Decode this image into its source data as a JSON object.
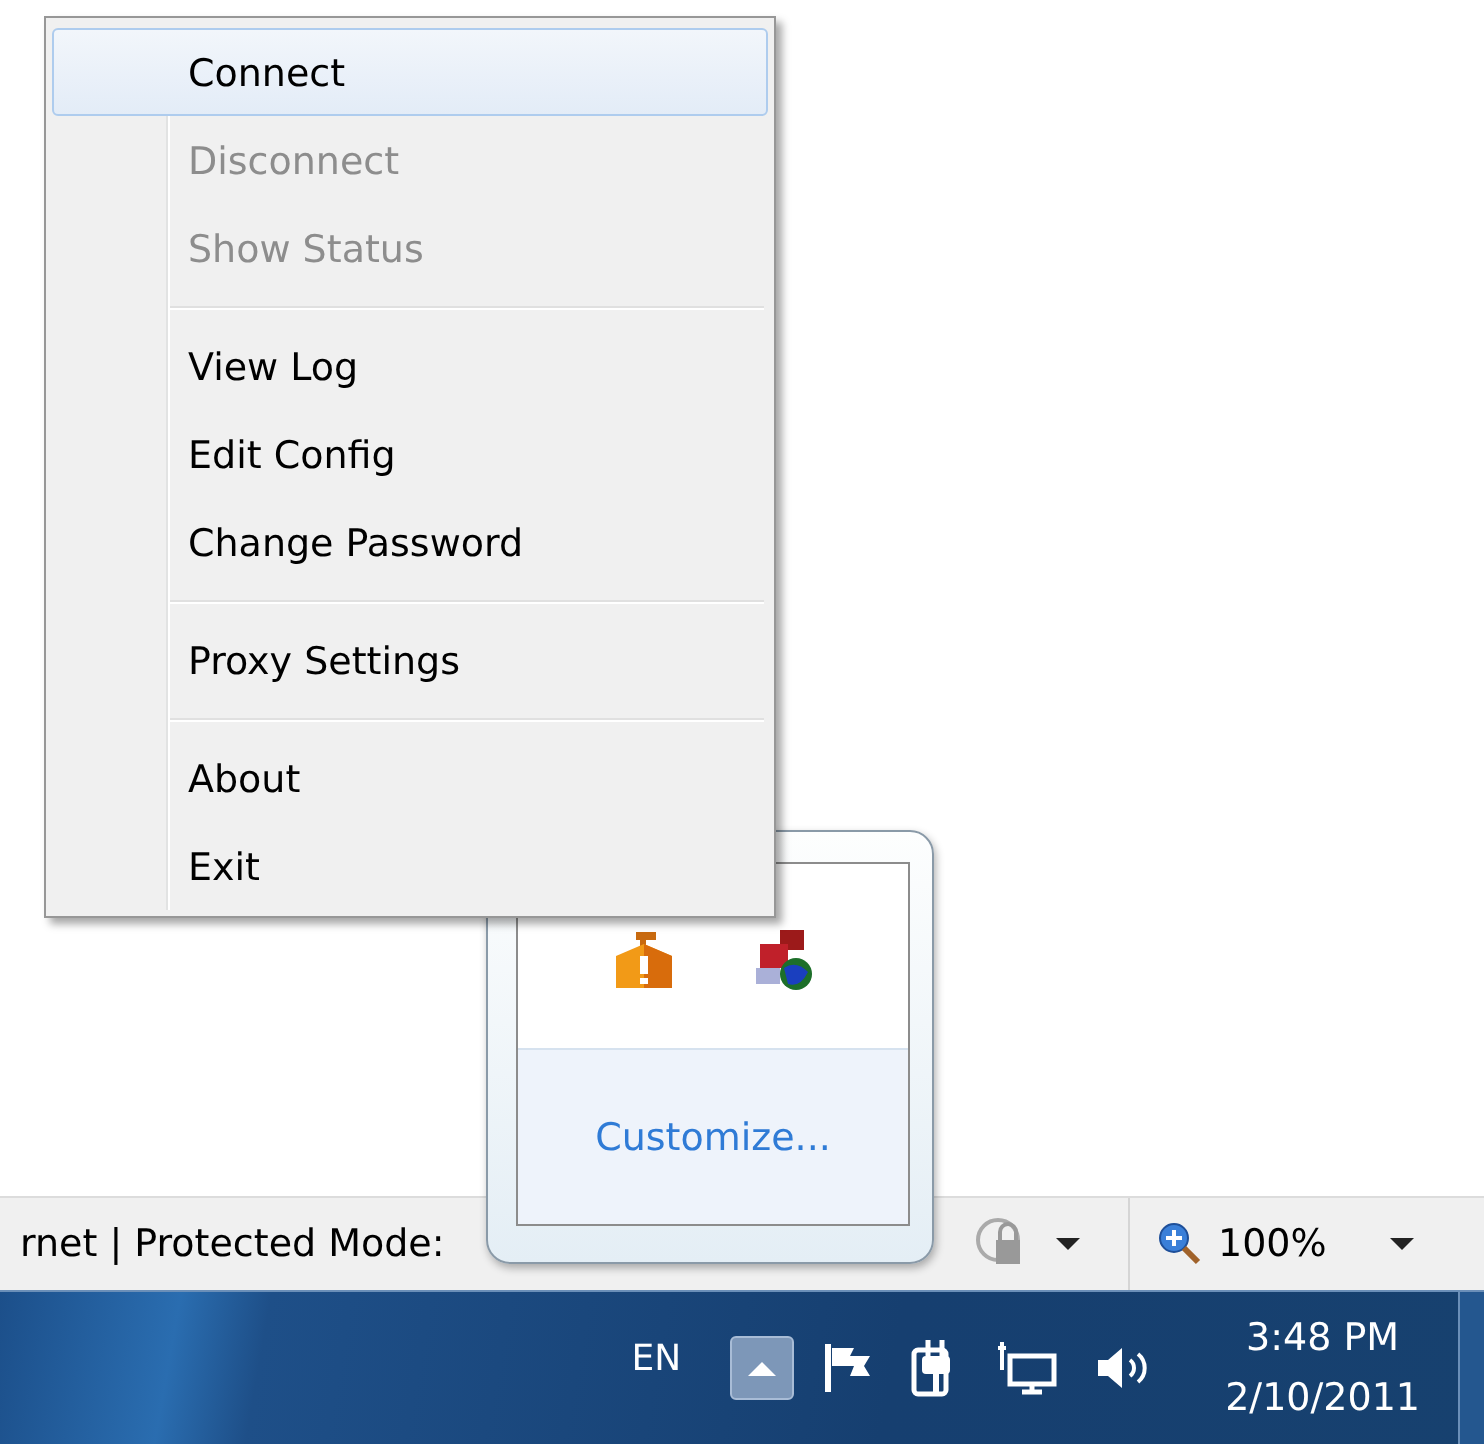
{
  "context_menu": {
    "groups": [
      [
        {
          "label": "Connect",
          "selected": true,
          "disabled": false
        },
        {
          "label": "Disconnect",
          "selected": false,
          "disabled": true
        },
        {
          "label": "Show Status",
          "selected": false,
          "disabled": true
        }
      ],
      [
        {
          "label": "View Log",
          "selected": false,
          "disabled": false
        },
        {
          "label": "Edit Config",
          "selected": false,
          "disabled": false
        },
        {
          "label": "Change Password",
          "selected": false,
          "disabled": false
        }
      ],
      [
        {
          "label": "Proxy Settings",
          "selected": false,
          "disabled": false
        }
      ],
      [
        {
          "label": "About",
          "selected": false,
          "disabled": false
        },
        {
          "label": "Exit",
          "selected": false,
          "disabled": false
        }
      ]
    ]
  },
  "tray_overflow": {
    "link": "Customize..."
  },
  "status_bar": {
    "text": "rnet | Protected Mode:",
    "zoom": "100%"
  },
  "taskbar": {
    "language": "EN",
    "hidden_icons_button": {
      "expanded": true
    },
    "time": "3:48 PM",
    "date": "2/10/2011"
  }
}
